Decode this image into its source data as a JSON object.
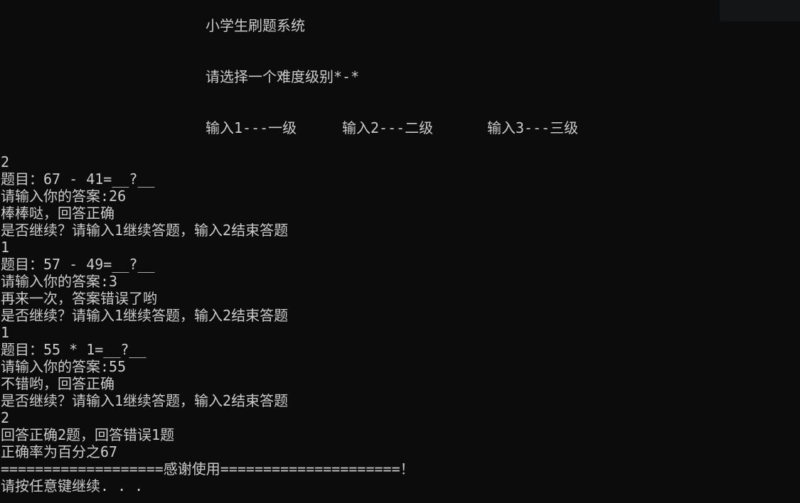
{
  "header": {
    "title": "小学生刷题系统",
    "prompt": "请选择一个难度级别*-*",
    "options": [
      "输入1---一级",
      "输入2---二级",
      "输入3---三级"
    ]
  },
  "output_lines": [
    "2",
    "题目：67 - 41=__?__",
    "请输入你的答案:26",
    "棒棒哒，回答正确",
    "是否继续？请输入1继续答题，输入2结束答题",
    "1",
    "题目：57 - 49=__?__",
    "请输入你的答案:3",
    "再来一次，答案错误了哟",
    "是否继续？请输入1继续答题，输入2结束答题",
    "1",
    "题目：55 * 1=__?__",
    "请输入你的答案:55",
    "不错哟，回答正确",
    "是否继续？请输入1继续答题，输入2结束答题",
    "2",
    "回答正确2题，回答错误1题",
    "正确率为百分之67",
    "===================感谢使用=====================！",
    "请按任意键继续. . ."
  ],
  "colors": {
    "background": "#0c0c0c",
    "text": "#cccccc"
  }
}
